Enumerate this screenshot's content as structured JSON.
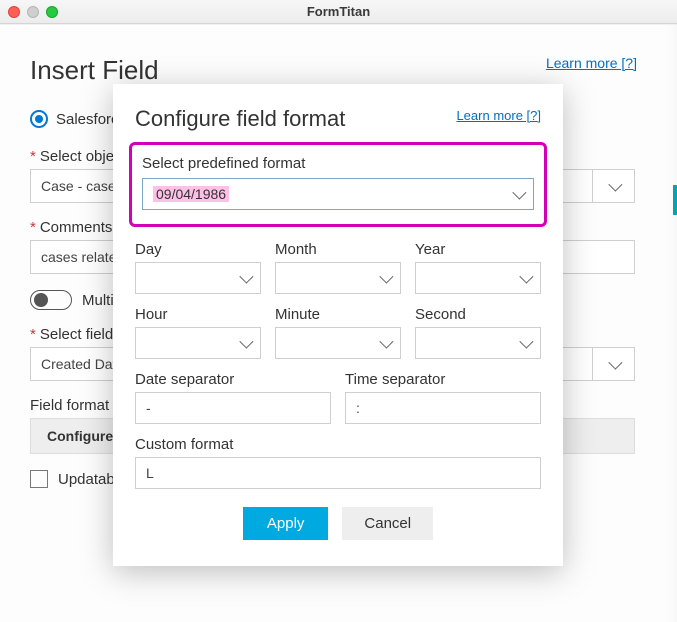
{
  "window": {
    "title": "FormTitan"
  },
  "page": {
    "title": "Insert Field",
    "learn_more": "Learn more [?]",
    "source_radio_label": "Salesforce",
    "select_object_label": "Select object",
    "select_object_value": "Case - cases",
    "comments_label": "Comments",
    "comments_value": "cases related",
    "multi_label": "Multi",
    "select_field_label": "Select field",
    "select_field_value": "Created Date",
    "field_format_label": "Field format",
    "configure_btn": "Configure",
    "updatable_label": "Updatable"
  },
  "modal": {
    "title": "Configure field format",
    "learn_more": "Learn more [?]",
    "predef_label": "Select predefined format",
    "predef_value": "09/04/1986",
    "day_label": "Day",
    "month_label": "Month",
    "year_label": "Year",
    "hour_label": "Hour",
    "minute_label": "Minute",
    "second_label": "Second",
    "date_sep_label": "Date separator",
    "date_sep_value": "-",
    "time_sep_label": "Time separator",
    "time_sep_value": ":",
    "custom_label": "Custom format",
    "custom_value": "L",
    "apply": "Apply",
    "cancel": "Cancel"
  }
}
